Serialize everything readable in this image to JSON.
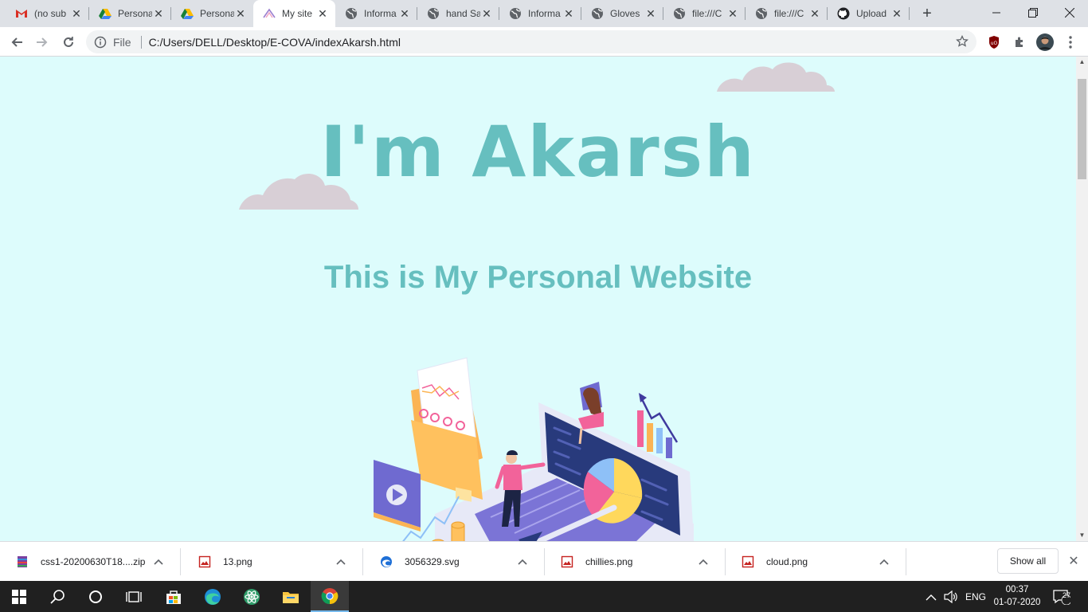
{
  "browser": {
    "tabs": [
      {
        "title": "(no sub",
        "icon": "gmail-icon"
      },
      {
        "title": "Persona",
        "icon": "drive-icon"
      },
      {
        "title": "Persona",
        "icon": "drive-icon"
      },
      {
        "title": "My site",
        "icon": "site-icon",
        "active": true
      },
      {
        "title": "Informa",
        "icon": "globe-icon"
      },
      {
        "title": "hand Sa",
        "icon": "globe-icon"
      },
      {
        "title": "Informa",
        "icon": "globe-icon"
      },
      {
        "title": "Gloves",
        "icon": "globe-icon"
      },
      {
        "title": "file:///C",
        "icon": "globe-icon"
      },
      {
        "title": "file:///C",
        "icon": "globe-icon"
      },
      {
        "title": "Upload",
        "icon": "github-icon"
      }
    ],
    "address": {
      "scheme_label": "File",
      "url": "C:/Users/DELL/Desktop/E-COVA/indexAkarsh.html"
    }
  },
  "page": {
    "title": "I'm Akarsh",
    "subtitle": "This is My Personal Website",
    "background": "#ddfcfc",
    "accent": "#66bfbf",
    "cloud_color": "#d8cfd6"
  },
  "downloads": {
    "items": [
      {
        "name": "css1-20200630T18....zip",
        "icon": "archive-icon"
      },
      {
        "name": "13.png",
        "icon": "image-file-icon"
      },
      {
        "name": "3056329.svg",
        "icon": "edge-file-icon"
      },
      {
        "name": "chillies.png",
        "icon": "image-file-icon"
      },
      {
        "name": "cloud.png",
        "icon": "image-file-icon"
      }
    ],
    "show_all_label": "Show all"
  },
  "taskbar": {
    "language": "ENG",
    "time": "00:37",
    "date": "01-07-2020",
    "notification_count": "27"
  }
}
